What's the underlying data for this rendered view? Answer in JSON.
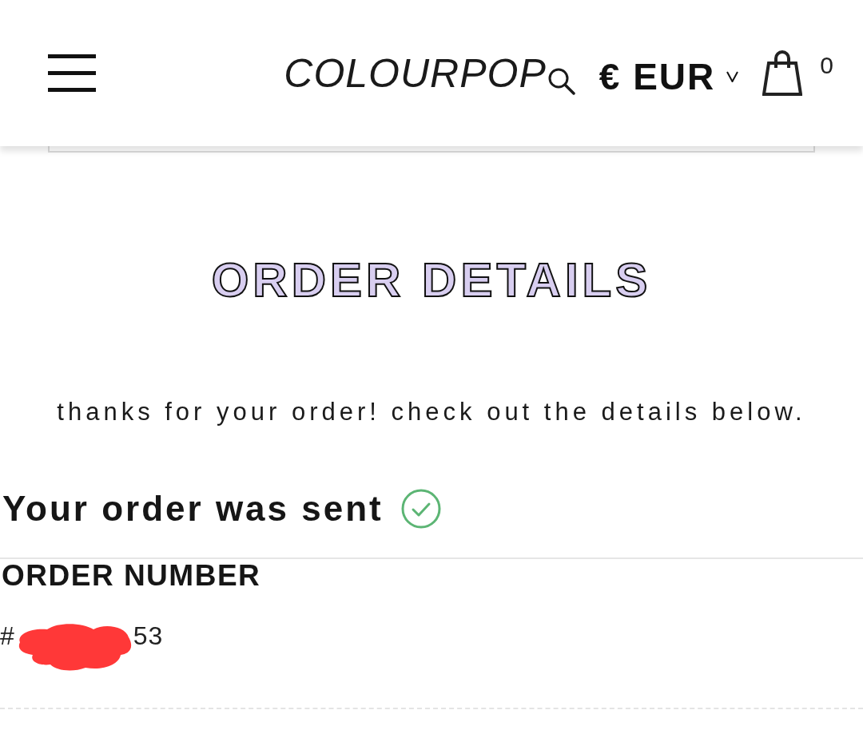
{
  "header": {
    "logo": "COLOURPOP",
    "currency": "€ EUR",
    "cart_count": "0"
  },
  "page": {
    "title": "ORDER DETAILS",
    "intro": "thanks for your order! check out the details below."
  },
  "status": {
    "text": "Your order was sent",
    "done": true
  },
  "order": {
    "label": "ORDER NUMBER",
    "number_start": "#",
    "number_end": "53",
    "redacted": true
  }
}
